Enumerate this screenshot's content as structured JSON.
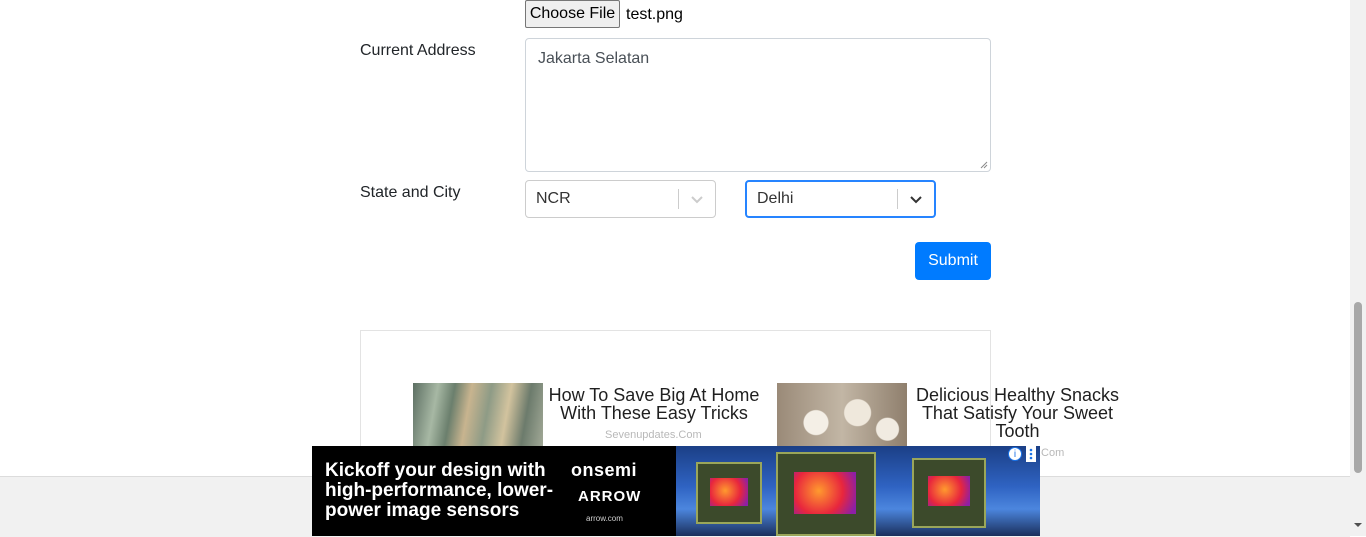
{
  "upload": {
    "button_label": "Choose File",
    "file_name": "test.png"
  },
  "address": {
    "label": "Current Address",
    "value": "Jakarta Selatan"
  },
  "location": {
    "label": "State and City",
    "state_value": "NCR",
    "city_value": "Delhi"
  },
  "submit_label": "Submit",
  "ads": [
    {
      "title": "How To Save Big At Home With These Easy Tricks",
      "source": "Sevenupdates.Com"
    },
    {
      "title": "Delicious Healthy Snacks That Satisfy Your Sweet Tooth",
      "source": ".Com"
    }
  ],
  "banner": {
    "headline": "Kickoff your design with high-performance, lower-power image sensors",
    "brand_primary": "onsemi",
    "brand_secondary": "ARROW",
    "url": "arrow.com",
    "info_icon": "i"
  },
  "colors": {
    "primary": "#007bff",
    "focus_border": "#2684ff"
  }
}
